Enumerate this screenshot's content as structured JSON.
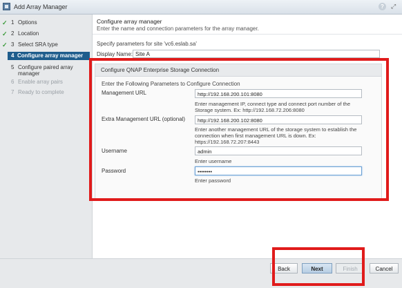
{
  "window": {
    "title": "Add Array Manager",
    "help_icon": "question-icon",
    "expand_icon": "expand-icon"
  },
  "steps": [
    {
      "num": "1",
      "label": "Options",
      "state": "done"
    },
    {
      "num": "2",
      "label": "Location",
      "state": "done"
    },
    {
      "num": "3",
      "label": "Select SRA type",
      "state": "done"
    },
    {
      "num": "4",
      "label": "Configure array manager",
      "state": "active"
    },
    {
      "num": "5",
      "label_line1": "Configure paired array",
      "label_line2": "manager",
      "state": "pending"
    },
    {
      "num": "6",
      "label": "Enable array pairs",
      "state": "disabled"
    },
    {
      "num": "7",
      "label": "Ready to complete",
      "state": "disabled"
    }
  ],
  "main": {
    "title": "Configure array manager",
    "subtitle": "Enter the name and connection parameters for the array manager.",
    "site_params": "Specify parameters for site 'vc6.eslab.sa'",
    "display_name_label": "Display Name:",
    "display_name_value": "Site A"
  },
  "connection": {
    "title": "Configure QNAP Enterprise Storage Connection",
    "description": "Enter the Following Parameters to Configure Connection",
    "mgmt_url_label": "Management URL",
    "mgmt_url_value": "http://192.168.200.101:8080",
    "mgmt_url_hint_1": "Enter management IP, connect type and connect port number of the",
    "mgmt_url_hint_2": "Storage system. Ex: http://192.168.72.206:8080",
    "extra_url_label": "Extra Management URL  (optional)",
    "extra_url_value": "http://192.168.200.102:8080",
    "extra_url_hint_1": "Enter another management URL of the storage system to establish the",
    "extra_url_hint_2": "connection when first management URL is down. Ex:",
    "extra_url_hint_3": "https://192.168.72.207:8443",
    "username_label": "Username",
    "username_value": "admin",
    "username_hint": "Enter username",
    "password_label": "Password",
    "password_value": "••••••••",
    "password_hint": "Enter password"
  },
  "footer": {
    "back": "Back",
    "next": "Next",
    "finish": "Finish",
    "cancel": "Cancel"
  },
  "colors": {
    "highlight": "#e01b1b",
    "active_step": "#1f5d8c",
    "check": "#3b9a3b"
  }
}
